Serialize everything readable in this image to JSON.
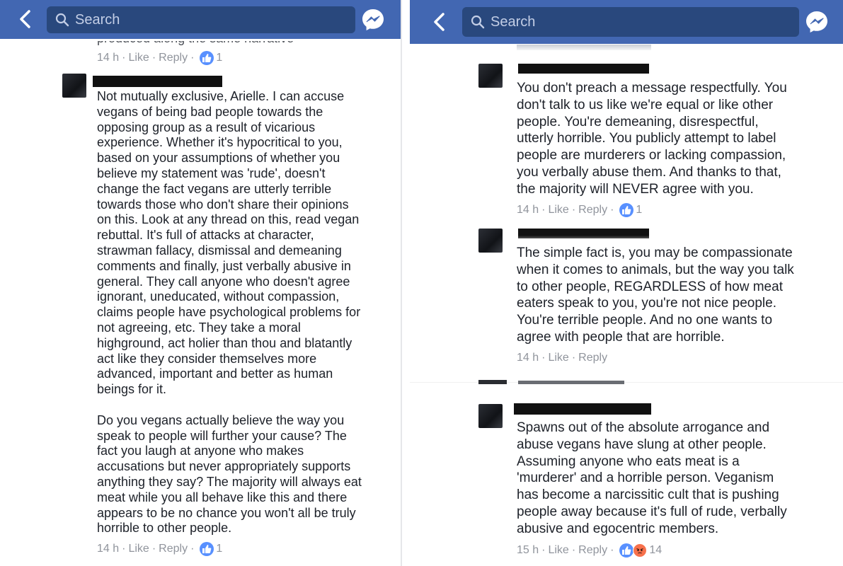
{
  "left_panel": {
    "search_placeholder": "Search",
    "clipped_prev_text": "produced along the same narrative",
    "top_meta": {
      "time": "14 h",
      "like": "Like",
      "reply": "Reply",
      "reactions": "1"
    },
    "comment": {
      "lines": [
        "Not mutually exclusive, Arielle. I can accuse",
        "vegans of being bad people towards the",
        "opposing group as a result of vicarious",
        "experience. Whether it's hypocritical to you,",
        "based on your assumptions of whether you",
        "believe my statement was 'rude', doesn't",
        "change the fact vegans are utterly terrible",
        "towards those who don't share their opinions",
        "on this. Look at any thread on this, read vegan",
        "rebuttal. It's full of attacks at character,",
        "strawman fallacy, dismissal and demeaning",
        "comments and finally, just verbally abusive in",
        "general. They call anyone who doesn't agree",
        "ignorant, uneducated, without compassion,",
        "claims people have psychological problems for",
        "not agreeing, etc. They take a moral",
        "highground, act holier than thou and blatantly",
        "act like they consider themselves more",
        "advanced, important and better as human",
        "beings for it.",
        "",
        "Do you vegans actually believe the way you",
        "speak to people will further your cause? The",
        "fact you laugh at anyone who makes",
        "accusations but never appropriately supports",
        "anything they say? The majority will always eat",
        "meat while you all behave like this and there",
        "appears to be no chance you won't all be truly",
        "horrible to other people."
      ],
      "meta": {
        "time": "14 h",
        "like": "Like",
        "reply": "Reply",
        "reactions": "1"
      }
    }
  },
  "right_panel": {
    "search_placeholder": "Search",
    "comments": [
      {
        "lines": [
          "You don't preach a message respectfully. You",
          "don't talk to us like we're equal or like other",
          "people. You're demeaning, disrespectful,",
          "utterly horrible. You publicly attempt to label",
          "people are murderers or lacking compassion,",
          "you verbally abuse them. And thanks to that,",
          "the majority will NEVER agree with you."
        ],
        "meta": {
          "time": "14 h",
          "like": "Like",
          "reply": "Reply",
          "reactions": "1"
        }
      },
      {
        "lines": [
          "The simple fact is, you may be compassionate",
          "when it comes to animals, but the way you talk",
          "to other people, REGARDLESS of how meat",
          "eaters speak to you, you're not nice people.",
          "You're terrible people. And no one wants to",
          "agree with people that are horrible."
        ],
        "meta": {
          "time": "14 h",
          "like": "Like",
          "reply": "Reply"
        }
      },
      {
        "lines": [
          "Spawns out of the absolute arrogance and",
          "abuse vegans have slung at other people.",
          "Assuming anyone who eats meat is a",
          "'murderer' and a horrible person. Veganism",
          "has become a narcissitic cult that is pushing",
          "people away because it's full of rude, verbally",
          "abusive and egocentric members."
        ],
        "meta": {
          "time": "15 h",
          "like": "Like",
          "reply": "Reply",
          "reactions": "14"
        }
      }
    ]
  },
  "colors": {
    "navbar": "#4267b2",
    "searchbox": "#29487d",
    "meta_text": "#90949c",
    "like_blue": "#5890ff",
    "angry_orange": "#f7714c"
  }
}
